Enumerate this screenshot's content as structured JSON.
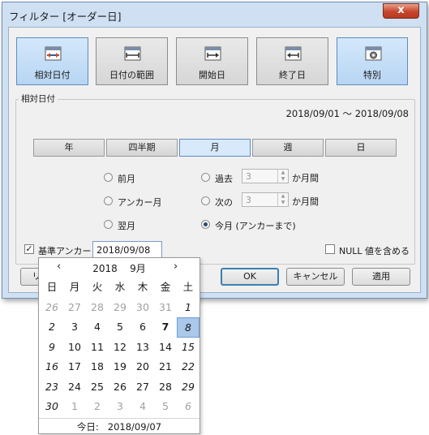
{
  "window": {
    "title": "フィルター [オーダー日]",
    "close_label": "x"
  },
  "modes": [
    {
      "label": "相対日付",
      "icon": "calendar-relative-icon"
    },
    {
      "label": "日付の範囲",
      "icon": "calendar-range-icon"
    },
    {
      "label": "開始日",
      "icon": "calendar-start-icon"
    },
    {
      "label": "終了日",
      "icon": "calendar-end-icon"
    },
    {
      "label": "特別",
      "icon": "calendar-special-icon"
    }
  ],
  "group": {
    "title": "相対日付",
    "range_text": "2018/09/01 〜 2018/09/08",
    "tabs": [
      "年",
      "四半期",
      "月",
      "週",
      "日"
    ],
    "selected_tab": "月",
    "radios": {
      "prev": "前月",
      "anchor_month": "アンカー月",
      "next_month": "翌月",
      "past": "過去",
      "next": "次の",
      "this_month": "今月 (アンカーまで)"
    },
    "past_value": "3",
    "next_value": "3",
    "months_suffix": "か月間",
    "anchor_label": "基準アンカー",
    "anchor_checked": true,
    "anchor_value": "2018/09/08",
    "null_label": "NULL 値を含める",
    "null_checked": false
  },
  "buttons": {
    "ok": "OK",
    "cancel": "キャンセル",
    "apply": "適用",
    "reset": "リ"
  },
  "calendar": {
    "prev": "‹",
    "next": "›",
    "year": "2018",
    "month": "9月",
    "weekdays": [
      "日",
      "月",
      "火",
      "水",
      "木",
      "金",
      "土"
    ],
    "weeks": [
      [
        "26",
        "27",
        "28",
        "29",
        "30",
        "31",
        "1"
      ],
      [
        "2",
        "3",
        "4",
        "5",
        "6",
        "7",
        "8"
      ],
      [
        "9",
        "10",
        "11",
        "12",
        "13",
        "14",
        "15"
      ],
      [
        "16",
        "17",
        "18",
        "19",
        "20",
        "21",
        "22"
      ],
      [
        "23",
        "24",
        "25",
        "26",
        "27",
        "28",
        "29"
      ],
      [
        "30",
        "1",
        "2",
        "3",
        "4",
        "5",
        "6"
      ]
    ],
    "today_label": "今日:",
    "today_value": "2018/09/07"
  }
}
